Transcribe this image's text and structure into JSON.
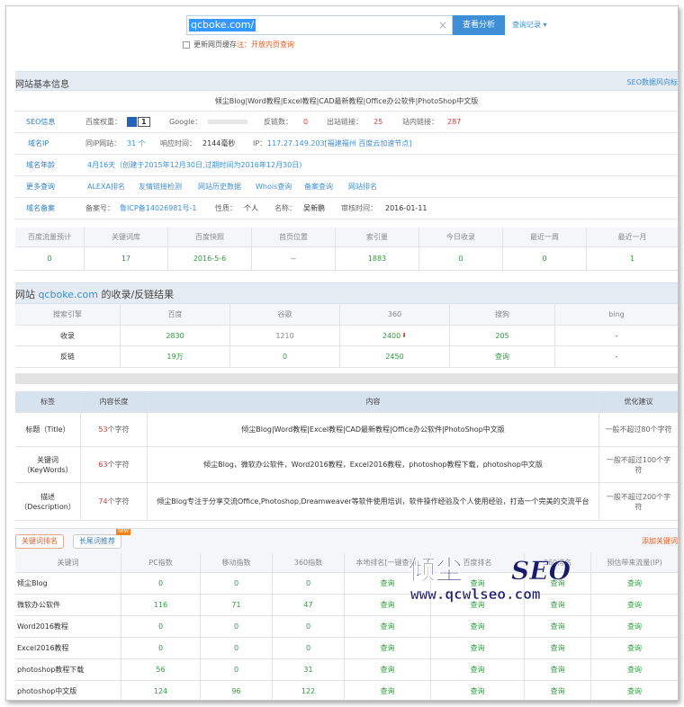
{
  "search": {
    "value": "qcboke.com/",
    "clear": "×",
    "button": "查看分析",
    "history": "查询记录 ▾",
    "refresh_label": "更新网页缓存",
    "refresh_note": "注：开放内页查询"
  },
  "basic": {
    "title": "网站基本信息",
    "right_link": "SEO数据风向标",
    "site_desc": "倾尘Blog|Word教程|Excel教程|CAD最新教程|Office办公软件|PhotoShop中文版",
    "rows": [
      {
        "label": "SEO信息",
        "items": [
          {
            "k": "百度权重：",
            "v": ""
          },
          {
            "k": "Google：",
            "v": ""
          },
          {
            "k": "反链数：",
            "v": "0"
          },
          {
            "k": "出站链接：",
            "v": "25"
          },
          {
            "k": "站内链接：",
            "v": "287"
          }
        ],
        "badge": "1"
      },
      {
        "label": "域名IP",
        "items": [
          {
            "k": "同IP网站：",
            "v": "31 个"
          },
          {
            "k": "响应时间：",
            "v": "2144毫秒"
          },
          {
            "k": "IP：",
            "v": "117.27.149.203[福建福州 百度云加速节点]"
          }
        ]
      },
      {
        "label": "域名年龄",
        "text": "4月16天（创建于2015年12月30日,过期时间为2016年12月30日）"
      },
      {
        "label": "更多查询",
        "links": [
          "ALEXA排名",
          "友情链接检测",
          "网站历史数据",
          "Whois查询",
          "备案查询",
          "网站排名"
        ]
      },
      {
        "label": "域名备案",
        "items": [
          {
            "k": "备案号：",
            "v": "鲁ICP备14026981号-1"
          },
          {
            "k": "性质：",
            "v": "个人"
          },
          {
            "k": "名称：",
            "v": "吴新鹏"
          },
          {
            "k": "审核时间：",
            "v": "2016-01-11"
          }
        ]
      }
    ]
  },
  "traffic": {
    "headers": [
      "百度流量预计",
      "关键词库",
      "百度快照",
      "首页位置",
      "索引量",
      "今日收录",
      "最近一周",
      "最近一月"
    ],
    "values": [
      "0",
      "17",
      "2016-5-6",
      "--",
      "1883",
      "0",
      "0",
      "1"
    ]
  },
  "index": {
    "title_pre": "网站 ",
    "title_site": "qcboke.com",
    "title_post": " 的收录/反链结果",
    "headers": [
      "搜索引擎",
      "百度",
      "谷歌",
      "360",
      "搜狗",
      "bing"
    ],
    "rows": [
      [
        "收录",
        "2830",
        "1210",
        "2400",
        "205",
        "-"
      ],
      [
        "反链",
        "19万",
        "0",
        "2450",
        "查询",
        "-"
      ]
    ],
    "down_arrow": "⬇"
  },
  "meta": {
    "headers": [
      "标签",
      "内容长度",
      "内容",
      "优化建议"
    ],
    "rows": [
      {
        "tag": "标题（Title）",
        "len": "53",
        "unit": " 个字符",
        "content": "倾尘Blog|Word教程|Excel教程|CAD最新教程|Office办公软件|PhotoShop中文版",
        "tip": "一般不超过80个字符"
      },
      {
        "tag": "关键词（KeyWords）",
        "len": "63",
        "unit": " 个字符",
        "content": "倾尘Blog，微软办公软件，Word2016教程，Excel2016教程，photoshop教程下载，photoshop中文版",
        "tip": "一般不超过100个字符"
      },
      {
        "tag": "描述（Description）",
        "len": "74",
        "unit": " 个字符",
        "content": "倾尘Blog专注于分享交流Office,Photoshop,Dreamweaver等软件使用培训，软件操作经验及个人使用经验，打造一个完美的交流平台",
        "tip": "一般不超过200个字符"
      }
    ]
  },
  "kw": {
    "tab1": "关键词排名",
    "tab2": "长尾词推荐",
    "new": "NEW",
    "add": "添加关键词",
    "headers": [
      "关键词",
      "PC指数",
      "移动指数",
      "360指数",
      "本地排名[一键查询]",
      "百度排名",
      "360排名",
      "预估带来流量(IP)"
    ],
    "rows": [
      [
        "倾尘Blog",
        "0",
        "0",
        "0",
        "查询",
        "查询",
        "查询",
        "查询"
      ],
      [
        "微软办公软件",
        "116",
        "71",
        "47",
        "查询",
        "查询",
        "查询",
        "查询"
      ],
      [
        "Word2016教程",
        "0",
        "0",
        "0",
        "查询",
        "查询",
        "查询",
        "查询"
      ],
      [
        "Excel2016教程",
        "0",
        "0",
        "0",
        "查询",
        "查询",
        "查询",
        "查询"
      ],
      [
        "photoshop教程下载",
        "56",
        "0",
        "31",
        "查询",
        "查询",
        "查询",
        "查询"
      ],
      [
        "photoshop中文版",
        "124",
        "96",
        "122",
        "查询",
        "查询",
        "查询",
        "查询"
      ]
    ]
  },
  "watermark": {
    "cn": "倾尘",
    "seo": "SEO",
    "url": "www.qcwlseo.com"
  },
  "colors": {
    "accent": "#3e8fd6",
    "bar": "#e5ebf3",
    "red": "#d63c3c",
    "green": "#2f9d3c"
  }
}
